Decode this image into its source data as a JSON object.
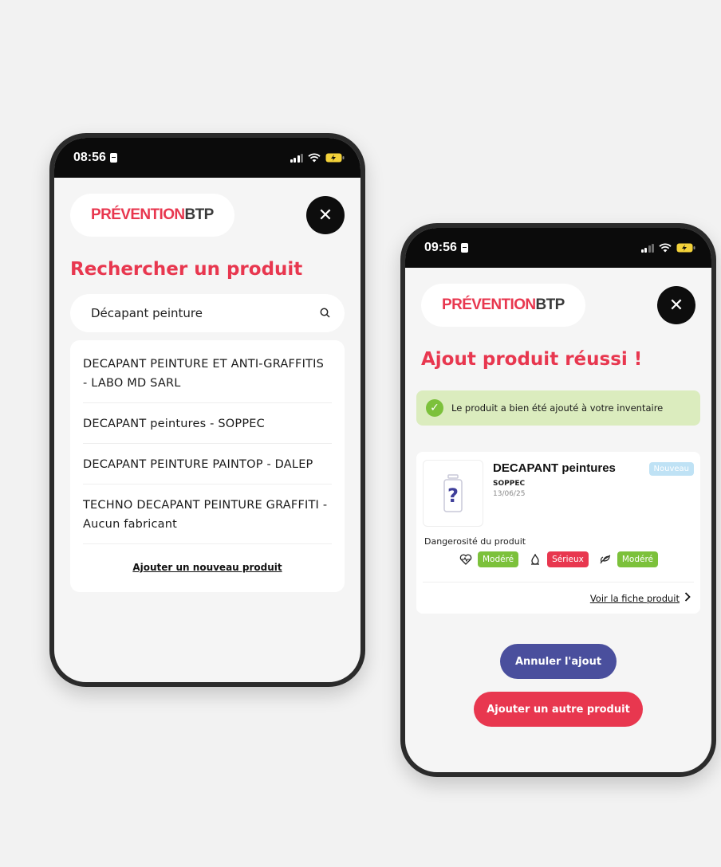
{
  "left_phone": {
    "status": {
      "time": "08:56"
    },
    "logo": {
      "red": "PRÉVENTION",
      "dark": "BTP"
    },
    "title": "Rechercher un produit",
    "search": {
      "value": "Décapant peinture"
    },
    "results": [
      "DECAPANT PEINTURE ET ANTI-GRAFFITIS - LABO MD SARL",
      "DECAPANT peintures - SOPPEC",
      "DECAPANT PEINTURE PAINTOP - DALEP",
      "TECHNO DECAPANT PEINTURE GRAFFITI - Aucun fabricant"
    ],
    "add_new_label": "Ajouter un nouveau produit"
  },
  "right_phone": {
    "status": {
      "time": "09:56"
    },
    "logo": {
      "red": "PRÉVENTION",
      "dark": "BTP"
    },
    "title": "Ajout produit réussi !",
    "success_message": "Le produit a bien été ajouté à votre inventaire",
    "product": {
      "name": "DECAPANT peintures",
      "manufacturer": "SOPPEC",
      "date": "13/06/25",
      "badge": "Nouveau",
      "danger_label": "Dangerosité du produit",
      "hazards": [
        {
          "icon": "health-icon",
          "level": "Modéré",
          "color": "#7cc13b"
        },
        {
          "icon": "flame-icon",
          "level": "Sérieux",
          "color": "#e8374f"
        },
        {
          "icon": "environment-icon",
          "level": "Modéré",
          "color": "#7cc13b"
        }
      ],
      "sheet_link": "Voir la fiche produit"
    },
    "cancel_button": "Annuler l'ajout",
    "add_another_button": "Ajouter un autre produit"
  },
  "colors": {
    "brand_red": "#e8374f",
    "brand_blue": "#4a4f9d",
    "success_green": "#7cc13b"
  }
}
